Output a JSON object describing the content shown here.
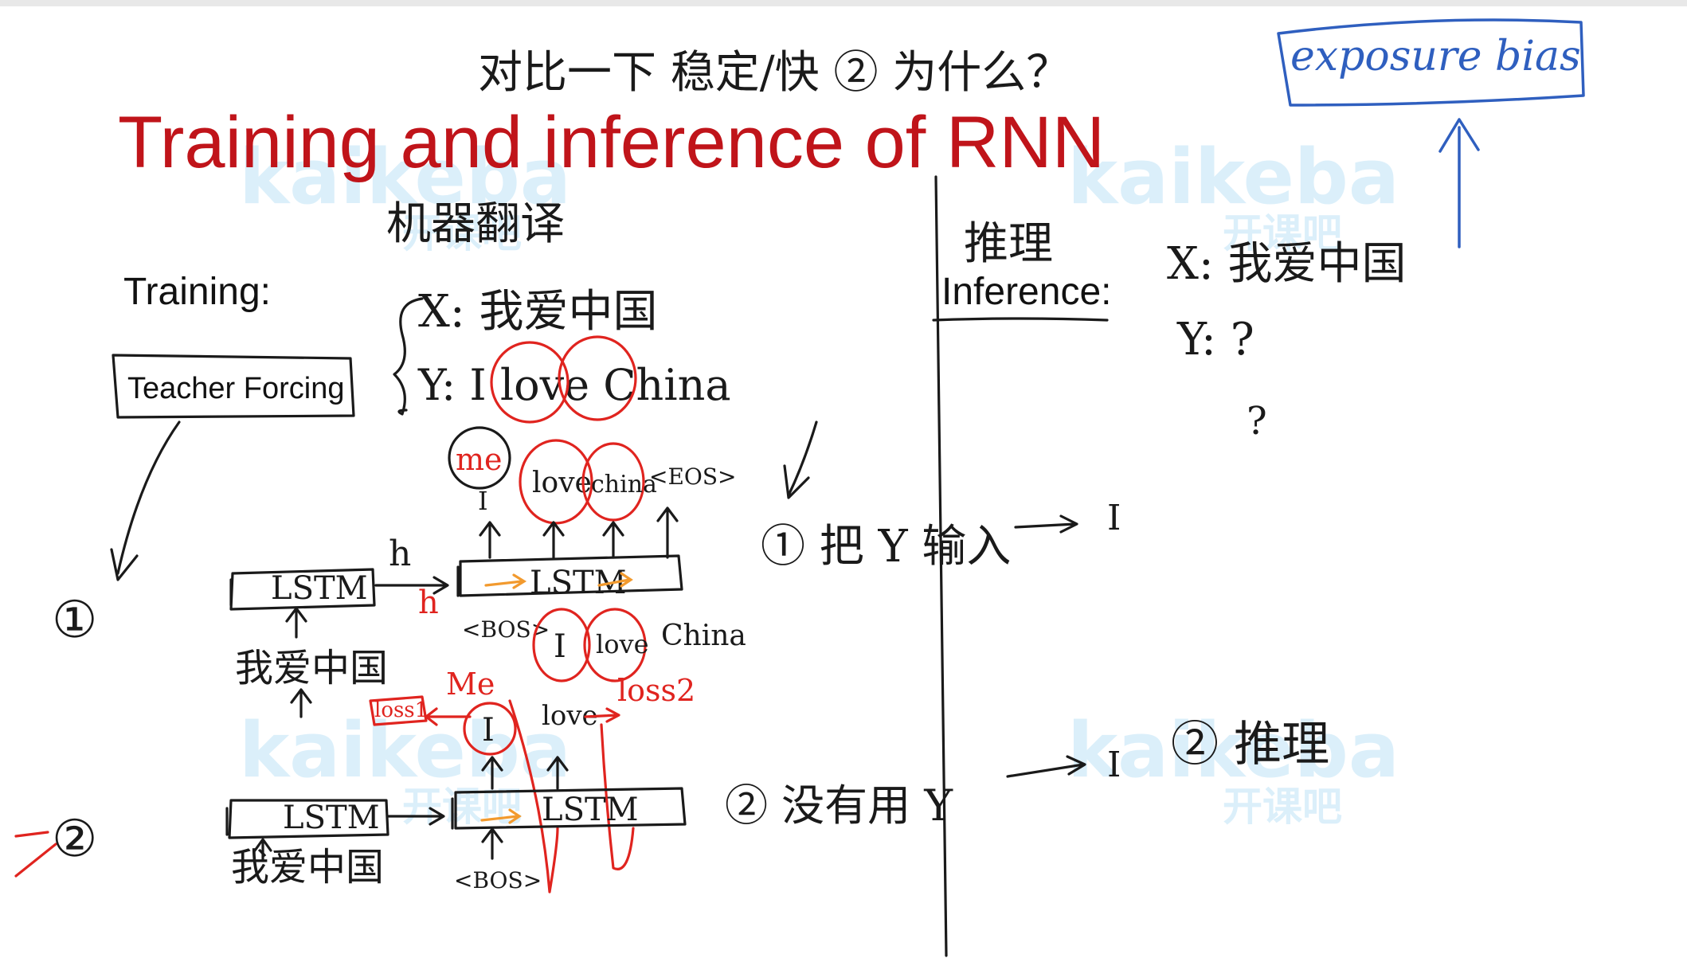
{
  "title": "Training and inference of RNN",
  "watermark": {
    "brand": "kaikeba",
    "brand_cn": "开课吧"
  },
  "sections": {
    "training_label": "Training:",
    "inference_label": "Inference:",
    "teacher_forcing_label": "Teacher Forcing",
    "exposure_bias_label": "exposure bias"
  },
  "notes": {
    "top_note": "对比一下 稳定/快 ② 为什么？",
    "machine_translation": "机器翻译",
    "inference_cn": "推理",
    "x_source": "X: 我爱中国",
    "y_target": "Y: I love China",
    "x_inference": "X: 我爱中国",
    "y_inference": "Y: ?",
    "question_mark": "?",
    "method_1": "① 把 Y 输入",
    "method_2": "② 没有用 Y",
    "circle_1": "①",
    "circle_2": "②",
    "inference_2": "② 推理",
    "h_label": "h",
    "h_label_red": "h",
    "lstm": "LSTM",
    "encoder_input_1": "我爱中国",
    "encoder_input_2": "我爱中国",
    "bos": "<BOS>",
    "eos": "<EOS>",
    "out_me": "me",
    "out_love": "love",
    "out_china": "china",
    "out_I": "I",
    "in_I": "I",
    "in_love": "love",
    "in_china": "China",
    "loss1_label": "loss1",
    "loss1_word": "Me",
    "loss2_label": "loss2",
    "bottom_I": "I",
    "bottom_love": "love",
    "inf_I_1": "I",
    "inf_I_2": "I"
  },
  "colors": {
    "title": "#c0141a",
    "ink": "#1a1a1a",
    "annotation": "#e0241f",
    "hidden": "#f29a2e",
    "exposure": "#2f5fbf",
    "watermark": "#bfe3f7"
  }
}
